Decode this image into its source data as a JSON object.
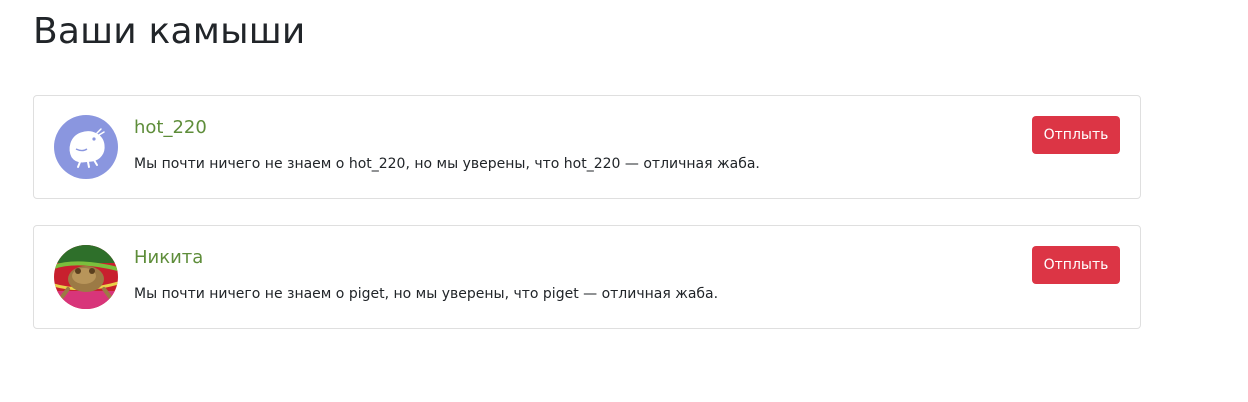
{
  "page": {
    "title": "Ваши камыши"
  },
  "following": [
    {
      "name": "hot_220",
      "description": "Мы почти ничего не знаем о hot_220, но мы уверены, что hot_220 — отличная жаба.",
      "button_label": "Отплыть",
      "avatar_icon": "default-avatar-icon",
      "avatar_color": "#8a96df"
    },
    {
      "name": "Никита",
      "description": "Мы почти ничего не знаем о piget, но мы уверены, что piget — отличная жаба.",
      "button_label": "Отплыть",
      "avatar_icon": "toad-photo-icon"
    }
  ],
  "colors": {
    "link": "#5e8d3a",
    "danger": "#dc3545",
    "border": "#dfdfdf"
  }
}
